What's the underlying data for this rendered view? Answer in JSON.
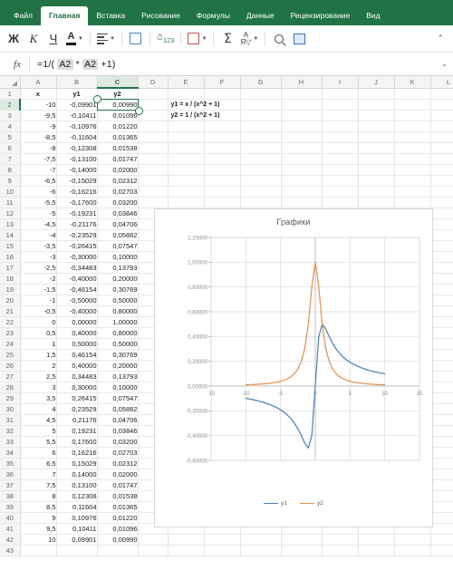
{
  "ribbon": {
    "tabs": [
      {
        "label": "Файл",
        "active": false
      },
      {
        "label": "Главная",
        "active": true
      },
      {
        "label": "Вставка",
        "active": false
      },
      {
        "label": "Рисование",
        "active": false
      },
      {
        "label": "Формулы",
        "active": false
      },
      {
        "label": "Данные",
        "active": false
      },
      {
        "label": "Рецензирование",
        "active": false
      },
      {
        "label": "Вид",
        "active": false
      }
    ]
  },
  "toolbar": {
    "bold": "Ж",
    "italic": "К",
    "underline": "Ч",
    "font_color": "A",
    "number_format": "123",
    "collapse": "⌃"
  },
  "formula_bar": {
    "fx": "fx",
    "prefix": "=1/( ",
    "ref1": "A2",
    "mid": " * ",
    "ref2": "A2",
    "suffix": " +1)",
    "full": "=1/( A2 * A2 +1)",
    "expand_caret": "⌄"
  },
  "sheet": {
    "columns": [
      "A",
      "B",
      "C",
      "D",
      "E",
      "F",
      "G",
      "H",
      "I",
      "J",
      "K",
      "L"
    ],
    "selected_column": "C",
    "selected_row": 2,
    "selected_cell": "C2",
    "headers": {
      "A": "x",
      "B": "y1",
      "C": "y2"
    },
    "notes": [
      {
        "row": 2,
        "col": "E",
        "text": "y1 = x / (x^2 + 1)"
      },
      {
        "row": 3,
        "col": "E",
        "text": "y2 = 1 / (x^2 + 1)"
      }
    ],
    "rows": [
      {
        "n": 1,
        "a": "x",
        "b": "y1",
        "c": "y2"
      },
      {
        "n": 2,
        "a": "-10",
        "b": "-0,09901",
        "c": "0,00990"
      },
      {
        "n": 3,
        "a": "-9,5",
        "b": "-0,10411",
        "c": "0,01096"
      },
      {
        "n": 4,
        "a": "-9",
        "b": "-0,10976",
        "c": "0,01220"
      },
      {
        "n": 5,
        "a": "-8,5",
        "b": "-0,11604",
        "c": "0,01365"
      },
      {
        "n": 6,
        "a": "-8",
        "b": "-0,12308",
        "c": "0,01538"
      },
      {
        "n": 7,
        "a": "-7,5",
        "b": "-0,13100",
        "c": "0,01747"
      },
      {
        "n": 8,
        "a": "-7",
        "b": "-0,14000",
        "c": "0,02000"
      },
      {
        "n": 9,
        "a": "-6,5",
        "b": "-0,15029",
        "c": "0,02312"
      },
      {
        "n": 10,
        "a": "-6",
        "b": "-0,16216",
        "c": "0,02703"
      },
      {
        "n": 11,
        "a": "-5,5",
        "b": "-0,17600",
        "c": "0,03200"
      },
      {
        "n": 12,
        "a": "-5",
        "b": "-0,19231",
        "c": "0,03846"
      },
      {
        "n": 13,
        "a": "-4,5",
        "b": "-0,21176",
        "c": "0,04706"
      },
      {
        "n": 14,
        "a": "-4",
        "b": "-0,23529",
        "c": "0,05882"
      },
      {
        "n": 15,
        "a": "-3,5",
        "b": "-0,26415",
        "c": "0,07547"
      },
      {
        "n": 16,
        "a": "-3",
        "b": "-0,30000",
        "c": "0,10000"
      },
      {
        "n": 17,
        "a": "-2,5",
        "b": "-0,34483",
        "c": "0,13793"
      },
      {
        "n": 18,
        "a": "-2",
        "b": "-0,40000",
        "c": "0,20000"
      },
      {
        "n": 19,
        "a": "-1,5",
        "b": "-0,46154",
        "c": "0,30769"
      },
      {
        "n": 20,
        "a": "-1",
        "b": "-0,50000",
        "c": "0,50000"
      },
      {
        "n": 21,
        "a": "-0,5",
        "b": "-0,40000",
        "c": "0,80000"
      },
      {
        "n": 22,
        "a": "0",
        "b": "0,00000",
        "c": "1,00000"
      },
      {
        "n": 23,
        "a": "0,5",
        "b": "0,40000",
        "c": "0,80000"
      },
      {
        "n": 24,
        "a": "1",
        "b": "0,50000",
        "c": "0,50000"
      },
      {
        "n": 25,
        "a": "1,5",
        "b": "0,46154",
        "c": "0,30769"
      },
      {
        "n": 26,
        "a": "2",
        "b": "0,40000",
        "c": "0,20000"
      },
      {
        "n": 27,
        "a": "2,5",
        "b": "0,34483",
        "c": "0,13793"
      },
      {
        "n": 28,
        "a": "3",
        "b": "0,30000",
        "c": "0,10000"
      },
      {
        "n": 29,
        "a": "3,5",
        "b": "0,26415",
        "c": "0,07547"
      },
      {
        "n": 30,
        "a": "4",
        "b": "0,23529",
        "c": "0,05882"
      },
      {
        "n": 31,
        "a": "4,5",
        "b": "0,21176",
        "c": "0,04706"
      },
      {
        "n": 32,
        "a": "5",
        "b": "0,19231",
        "c": "0,03846"
      },
      {
        "n": 33,
        "a": "5,5",
        "b": "0,17600",
        "c": "0,03200"
      },
      {
        "n": 34,
        "a": "6",
        "b": "0,16216",
        "c": "0,02703"
      },
      {
        "n": 35,
        "a": "6,5",
        "b": "0,15029",
        "c": "0,02312"
      },
      {
        "n": 36,
        "a": "7",
        "b": "0,14000",
        "c": "0,02000"
      },
      {
        "n": 37,
        "a": "7,5",
        "b": "0,13100",
        "c": "0,01747"
      },
      {
        "n": 38,
        "a": "8",
        "b": "0,12308",
        "c": "0,01538"
      },
      {
        "n": 39,
        "a": "8,5",
        "b": "0,11604",
        "c": "0,01365"
      },
      {
        "n": 40,
        "a": "9",
        "b": "0,10976",
        "c": "0,01220"
      },
      {
        "n": 41,
        "a": "9,5",
        "b": "0,10411",
        "c": "0,01096"
      },
      {
        "n": 42,
        "a": "10",
        "b": "0,09901",
        "c": "0,00990"
      },
      {
        "n": 43,
        "a": "",
        "b": "",
        "c": ""
      }
    ]
  },
  "chart_data": {
    "type": "line",
    "title": "Графики",
    "xlabel": "",
    "ylabel": "",
    "xlim": [
      -15,
      15
    ],
    "ylim": [
      -0.6,
      1.2
    ],
    "xticks": [
      -15,
      -10,
      -5,
      0,
      5,
      10,
      15
    ],
    "xticklabels": [
      "-15",
      "-10",
      "-5",
      "0",
      "5",
      "10",
      "15"
    ],
    "yticks": [
      -0.6,
      -0.4,
      -0.2,
      0.0,
      0.2,
      0.4,
      0.6,
      0.8,
      1.0,
      1.2
    ],
    "yticklabels": [
      "-0,60000",
      "-0,40000",
      "-0,20000",
      "0,00000",
      "0,20000",
      "0,40000",
      "0,60000",
      "0,80000",
      "1,00000",
      "1,20000"
    ],
    "grid": true,
    "legend_position": "bottom",
    "colors": {
      "y1": "#4e81bd",
      "y2": "#e0924f",
      "grid": "#d9d9d9",
      "text": "#8c8c8c"
    },
    "x": [
      -10,
      -9.5,
      -9,
      -8.5,
      -8,
      -7.5,
      -7,
      -6.5,
      -6,
      -5.5,
      -5,
      -4.5,
      -4,
      -3.5,
      -3,
      -2.5,
      -2,
      -1.5,
      -1,
      -0.5,
      0,
      0.5,
      1,
      1.5,
      2,
      2.5,
      3,
      3.5,
      4,
      4.5,
      5,
      5.5,
      6,
      6.5,
      7,
      7.5,
      8,
      8.5,
      9,
      9.5,
      10
    ],
    "series": [
      {
        "name": "y1",
        "color": "#4e81bd",
        "values": [
          -0.09901,
          -0.10411,
          -0.10976,
          -0.11604,
          -0.12308,
          -0.131,
          -0.14,
          -0.15029,
          -0.16216,
          -0.176,
          -0.19231,
          -0.21176,
          -0.23529,
          -0.26415,
          -0.3,
          -0.34483,
          -0.4,
          -0.46154,
          -0.5,
          -0.4,
          0.0,
          0.4,
          0.5,
          0.46154,
          0.4,
          0.34483,
          0.3,
          0.26415,
          0.23529,
          0.21176,
          0.19231,
          0.176,
          0.16216,
          0.15029,
          0.14,
          0.131,
          0.12308,
          0.11604,
          0.10976,
          0.10411,
          0.09901
        ]
      },
      {
        "name": "y2",
        "color": "#e0924f",
        "values": [
          0.0099,
          0.01096,
          0.0122,
          0.01365,
          0.01538,
          0.01747,
          0.02,
          0.02312,
          0.02703,
          0.032,
          0.03846,
          0.04706,
          0.05882,
          0.07547,
          0.1,
          0.13793,
          0.2,
          0.30769,
          0.5,
          0.8,
          1.0,
          0.8,
          0.5,
          0.30769,
          0.2,
          0.13793,
          0.1,
          0.07547,
          0.05882,
          0.04706,
          0.03846,
          0.032,
          0.02703,
          0.02312,
          0.02,
          0.01747,
          0.01538,
          0.01365,
          0.0122,
          0.01096,
          0.0099
        ]
      }
    ]
  }
}
